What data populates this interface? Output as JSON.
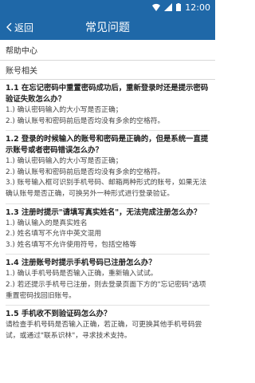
{
  "status": {
    "time": "12:00"
  },
  "appbar": {
    "back_label": "返回",
    "title": "常见问题"
  },
  "help_center": "帮助中心",
  "section": "账号相关",
  "faq": [
    {
      "q": "1.1 在忘记密码中重置密码成功后，重新登录时还是提示密码验证失败怎么办？",
      "a": [
        "1.) 确认密码输入的大小写是否正确；",
        "2.) 确认账号和密码前后是否均没有多余的空格符。"
      ]
    },
    {
      "q": "1.2 登录的时候输入的账号和密码是正确的，但是系统一直提示账号或者密码错误怎么办？",
      "a": [
        "1.) 确认密码输入的大小写是否正确；",
        "2.) 确认账号和密码前后是否均没有多余的空格符。",
        "3.) 账号输入框可识别手机号码、邮箱两种形式的账号，如果无法确认账号是否正确，可换另外一种形式进行登录验证。"
      ]
    },
    {
      "q": "1.3 注册时提示\"请填写真实姓名\"，无法完成注册怎么办？",
      "a": [
        "1.) 确认输入的是真实姓名",
        "2.) 姓名填写不允许中英文混用",
        "3.) 姓名填写不允许使用符号，包括空格等"
      ]
    },
    {
      "q": "1.4 注册账号时提示手机号码已注册怎么办？",
      "a": [
        "1.) 确认手机号码是否输入正确，重新输入试试。",
        "2.) 若还提示手机号已注册，则去登录页面下方的\"忘记密码\"选项重置密码找回旧账号。"
      ]
    },
    {
      "q": "1.5 手机收不到验证码怎么办？",
      "a": [
        "请检查手机号码是否输入正确，若正确，可更换其他手机号码尝试，或通过\"联系识林\"，寻求技术支持。"
      ]
    }
  ]
}
